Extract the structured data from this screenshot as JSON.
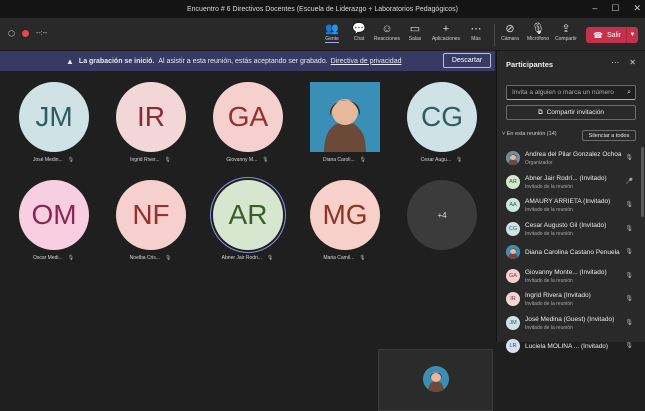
{
  "window": {
    "title": "Encuentro # 6 Directivos Docentes (Escuela de Liderazgo + Laboratorios Pedagógicos)",
    "controls": [
      "–",
      "☐",
      "✕"
    ]
  },
  "toolbar": {
    "timer": "--:--",
    "buttons": [
      {
        "label": "Gente",
        "icon": "people-icon",
        "glyph": "👥"
      },
      {
        "label": "Chat",
        "icon": "chat-icon",
        "glyph": "💬"
      },
      {
        "label": "Reacciones",
        "icon": "reactions-icon",
        "glyph": "☺"
      },
      {
        "label": "Salas",
        "icon": "rooms-icon",
        "glyph": "▭"
      },
      {
        "label": "Aplicaciones",
        "icon": "apps-icon",
        "glyph": "+"
      },
      {
        "label": "Más",
        "icon": "more-icon",
        "glyph": "⋯"
      },
      {
        "label": "Cámara",
        "icon": "camera-off-icon",
        "glyph": "⊘"
      },
      {
        "label": "Micrófono",
        "icon": "mic-off-icon",
        "glyph": "🎙"
      },
      {
        "label": "Compartir",
        "icon": "share-icon",
        "glyph": "⇪"
      }
    ],
    "leave_label": "Salir"
  },
  "banner": {
    "bold": "La grabación se inició.",
    "text": "Al asistir a esta reunión, estás aceptando ser grabado.",
    "link": "Directiva de privacidad",
    "dismiss": "Descartar"
  },
  "stage": {
    "tiles": [
      {
        "initials": "JM",
        "name": "José Medin...",
        "bg": "#cfe3e6",
        "fg": "#2f5c63"
      },
      {
        "initials": "IR",
        "name": "Ingrid River...",
        "bg": "#f3d6d8",
        "fg": "#8a2a33"
      },
      {
        "initials": "GA",
        "name": "Giovanny M...",
        "bg": "#f5d0cf",
        "fg": "#9a2e2a"
      },
      {
        "initials": "",
        "name": "Diana Caroli...",
        "bg": "#3a8fb7",
        "fg": "#ffffff"
      },
      {
        "initials": "CG",
        "name": "Cesar Augu...",
        "bg": "#cfe3e6",
        "fg": "#2f5c63"
      },
      {
        "initials": "OM",
        "name": "Oscar Medi...",
        "bg": "#f7cfe0",
        "fg": "#8e2456"
      },
      {
        "initials": "NF",
        "name": "Noelba Cris...",
        "bg": "#f5d0cf",
        "fg": "#9a2e2a"
      },
      {
        "initials": "AR",
        "name": "Abner Jair Rodri...",
        "bg": "#d6e6cf",
        "fg": "#3a5f2c"
      },
      {
        "initials": "MG",
        "name": "Maria Camil...",
        "bg": "#f7d1c9",
        "fg": "#8d3424"
      },
      {
        "initials": "+4",
        "name": "",
        "bg": "#3b3b3b",
        "fg": "#e0e0e0"
      }
    ]
  },
  "panel": {
    "title": "Participantes",
    "search_placeholder": "Invita a alguien o marca un número",
    "share_invite": "Compartir invitación",
    "section_label": "En esta reunión (14)",
    "mute_all": "Silenciar a todos",
    "participants": [
      {
        "name": "Andrea del Pilar Gonzalez Ochoa",
        "role": "Organizador",
        "initials": "",
        "bg": "#6b8fa8",
        "fg": "#fff",
        "photo": true
      },
      {
        "name": "Abner Jair Rodrí... (Invitado)",
        "role": "Invitado de la reunión",
        "initials": "AR",
        "bg": "#d6e6cf",
        "fg": "#3a5f2c",
        "mic": "on"
      },
      {
        "name": "AMAURY ARRIETA (Invitado)",
        "role": "Invitado de la reunión",
        "initials": "AA",
        "bg": "#cfe6dc",
        "fg": "#2c5f48"
      },
      {
        "name": "Cesar Augusto Gil (Invitado)",
        "role": "Invitado de la reunión",
        "initials": "CG",
        "bg": "#cfe3e6",
        "fg": "#2f5c63"
      },
      {
        "name": "Diana Carolina Castano Penuela",
        "role": "",
        "initials": "",
        "bg": "#3a8fb7",
        "fg": "#fff",
        "photo": true
      },
      {
        "name": "Giovanny Monte... (Invitado)",
        "role": "Invitado de la reunión",
        "initials": "GA",
        "bg": "#f5d0cf",
        "fg": "#9a2e2a"
      },
      {
        "name": "Ingrid Rivera (Invitado)",
        "role": "Invitado de la reunión",
        "initials": "IR",
        "bg": "#f3d6d8",
        "fg": "#8a2a33"
      },
      {
        "name": "José Medina (Guest) (Invitado)",
        "role": "Invitado de la reunión",
        "initials": "JM",
        "bg": "#cfe3e6",
        "fg": "#2f5c63"
      },
      {
        "name": "Luciela MOLINA ... (Invitado)",
        "role": "",
        "initials": "LR",
        "bg": "#d6e0f3",
        "fg": "#2c3f6b"
      }
    ]
  }
}
